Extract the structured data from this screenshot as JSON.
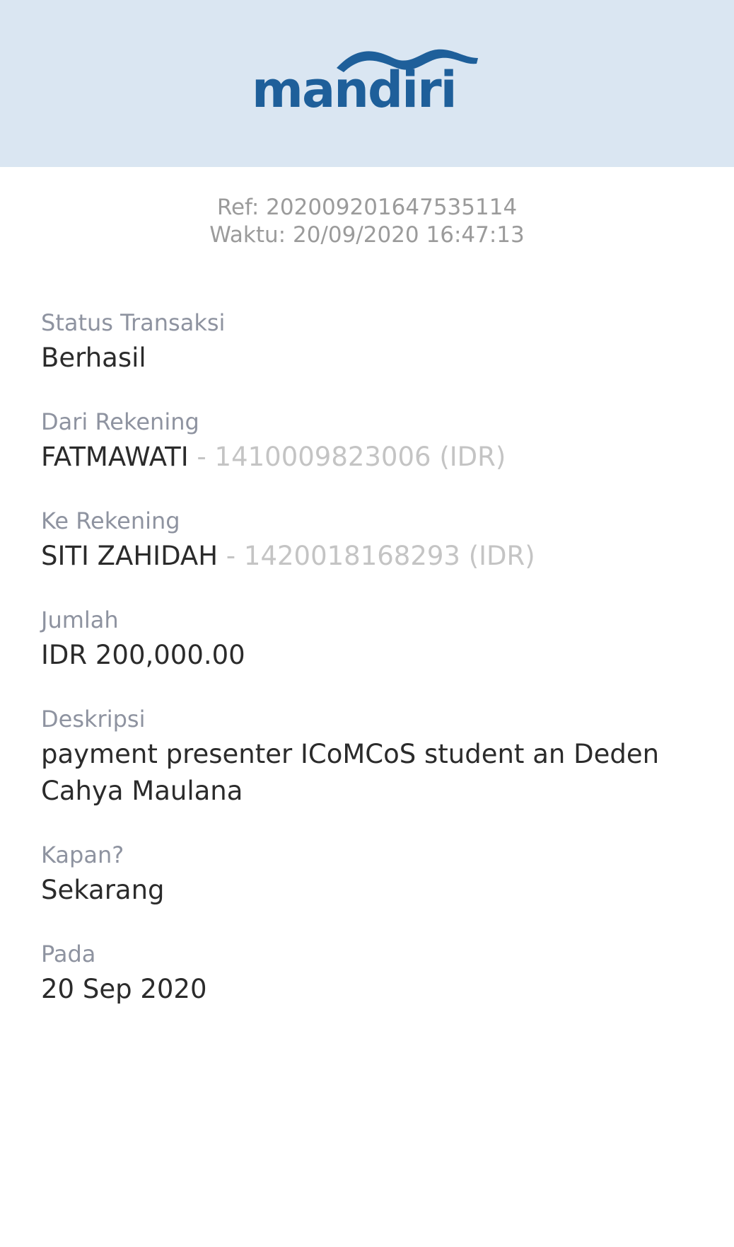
{
  "header": {
    "logo_text": "mandiri",
    "background_color": "#dae6f2",
    "brand_color": "#1e5f9a"
  },
  "meta": {
    "ref": "Ref: 202009201647535114",
    "time": "Waktu: 20/09/2020 16:47:13"
  },
  "fields": {
    "status": {
      "label": "Status Transaksi",
      "value": "Berhasil"
    },
    "from_account": {
      "label": "Dari Rekening",
      "name": "FATMAWATI",
      "number": " - 1410009823006 (IDR)"
    },
    "to_account": {
      "label": "Ke Rekening",
      "name": "SITI ZAHIDAH",
      "number": " - 1420018168293 (IDR)"
    },
    "amount": {
      "label": "Jumlah",
      "value": "IDR 200,000.00"
    },
    "description": {
      "label": "Deskripsi",
      "value": "payment presenter ICoMCoS student an Deden Cahya Maulana"
    },
    "when": {
      "label": "Kapan?",
      "value": "Sekarang"
    },
    "date": {
      "label": "Pada",
      "value": "20 Sep 2020"
    }
  }
}
